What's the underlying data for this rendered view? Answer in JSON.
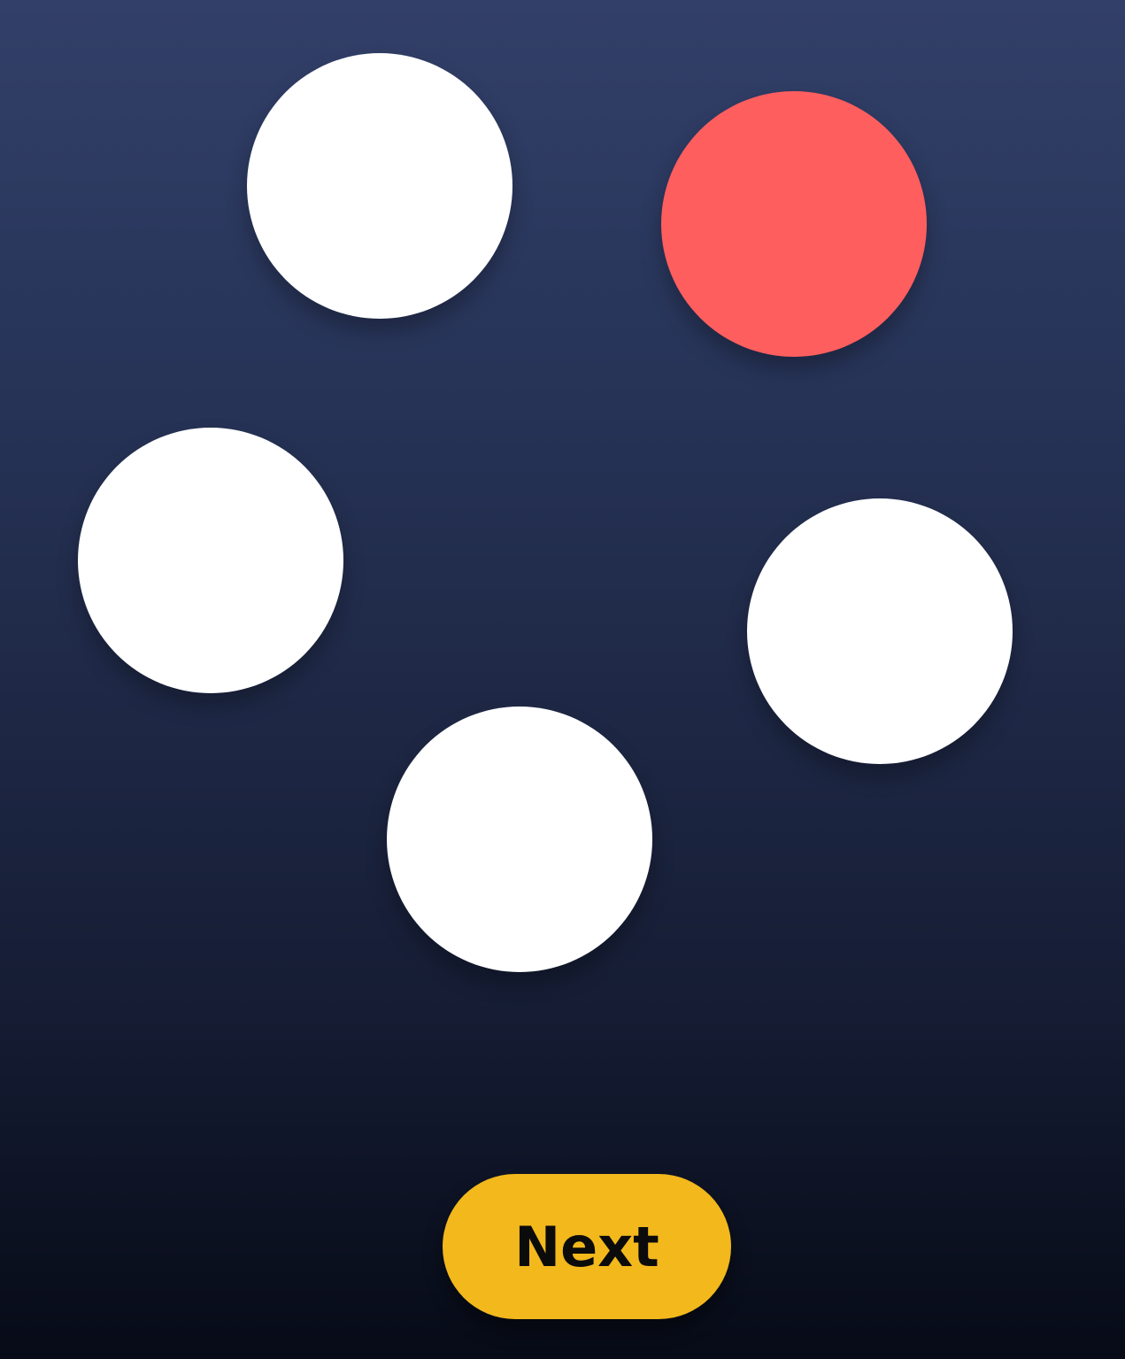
{
  "colors": {
    "background_top": "#323f68",
    "background_bottom": "#070b17",
    "circle_default": "#ffffff",
    "circle_highlight": "#ff5e5e",
    "button": "#f2b81c",
    "button_text": "#0b0b0b"
  },
  "circles": [
    {
      "id": "circle-1",
      "color": "#ffffff",
      "highlighted": false
    },
    {
      "id": "circle-2",
      "color": "#ff5e5e",
      "highlighted": true
    },
    {
      "id": "circle-3",
      "color": "#ffffff",
      "highlighted": false
    },
    {
      "id": "circle-4",
      "color": "#ffffff",
      "highlighted": false
    },
    {
      "id": "circle-5",
      "color": "#ffffff",
      "highlighted": false
    }
  ],
  "next_button": {
    "label": "Next"
  }
}
